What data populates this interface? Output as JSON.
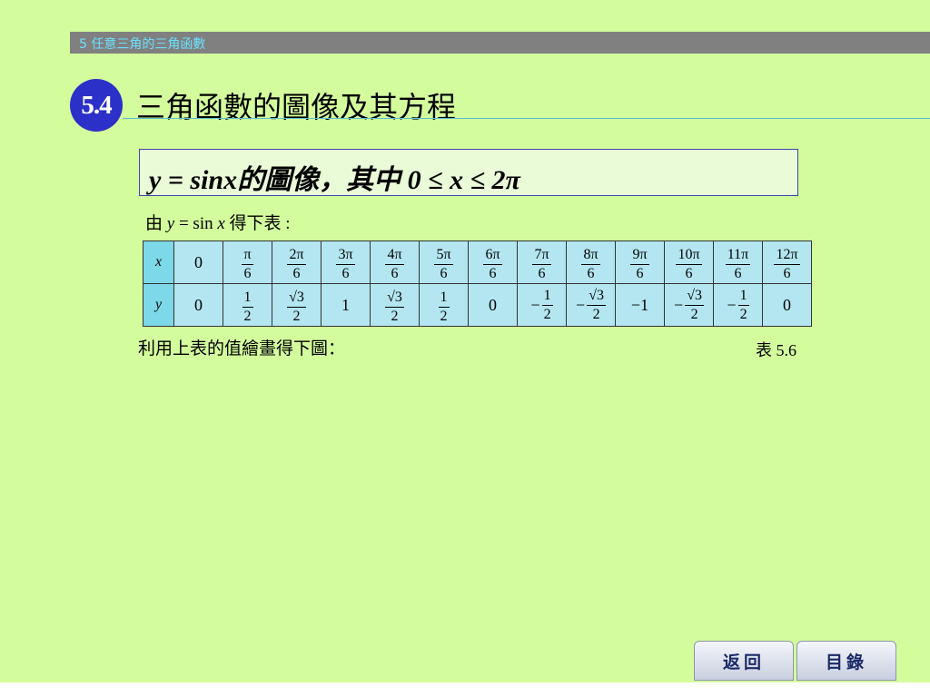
{
  "header": {
    "chapter": "5 任意三角的三角函數"
  },
  "section": {
    "number": "5.4",
    "title": "三角函數的圖像及其方程"
  },
  "topic": {
    "text": "y = sinx的圖像，其中 0 ≤  x ≤  2π"
  },
  "intro": {
    "prefix": "由 ",
    "var_y": "y",
    "eq": " = sin ",
    "var_x": "x",
    "suffix": " 得下表 :"
  },
  "table": {
    "x_label": "x",
    "y_label": "y",
    "x_values": [
      {
        "type": "int",
        "val": "0"
      },
      {
        "type": "frac",
        "num": "π",
        "den": "6"
      },
      {
        "type": "frac",
        "num": "2π",
        "den": "6"
      },
      {
        "type": "frac",
        "num": "3π",
        "den": "6"
      },
      {
        "type": "frac",
        "num": "4π",
        "den": "6"
      },
      {
        "type": "frac",
        "num": "5π",
        "den": "6"
      },
      {
        "type": "frac",
        "num": "6π",
        "den": "6"
      },
      {
        "type": "frac",
        "num": "7π",
        "den": "6"
      },
      {
        "type": "frac",
        "num": "8π",
        "den": "6"
      },
      {
        "type": "frac",
        "num": "9π",
        "den": "6"
      },
      {
        "type": "frac",
        "num": "10π",
        "den": "6"
      },
      {
        "type": "frac",
        "num": "11π",
        "den": "6"
      },
      {
        "type": "frac",
        "num": "12π",
        "den": "6"
      }
    ],
    "y_values": [
      {
        "type": "int",
        "val": "0"
      },
      {
        "type": "frac",
        "num": "1",
        "den": "2"
      },
      {
        "type": "frac",
        "num": "√3",
        "den": "2"
      },
      {
        "type": "int",
        "val": "1"
      },
      {
        "type": "frac",
        "num": "√3",
        "den": "2"
      },
      {
        "type": "frac",
        "num": "1",
        "den": "2"
      },
      {
        "type": "int",
        "val": "0"
      },
      {
        "type": "frac",
        "sign": "−",
        "num": "1",
        "den": "2"
      },
      {
        "type": "frac",
        "sign": "−",
        "num": "√3",
        "den": "2"
      },
      {
        "type": "int",
        "val": "−1"
      },
      {
        "type": "frac",
        "sign": "−",
        "num": "√3",
        "den": "2"
      },
      {
        "type": "frac",
        "sign": "−",
        "num": "1",
        "den": "2"
      },
      {
        "type": "int",
        "val": "0"
      }
    ]
  },
  "caption": {
    "left": "利用上表的值繪畫得下圖：",
    "right": "表 5.6"
  },
  "nav": {
    "back": "返回",
    "contents": "目錄"
  },
  "colors": {
    "background": "#d3fc9d",
    "badge": "#2b30c8",
    "table_cell": "#b3e6f0",
    "table_header": "#7dd8e8"
  }
}
